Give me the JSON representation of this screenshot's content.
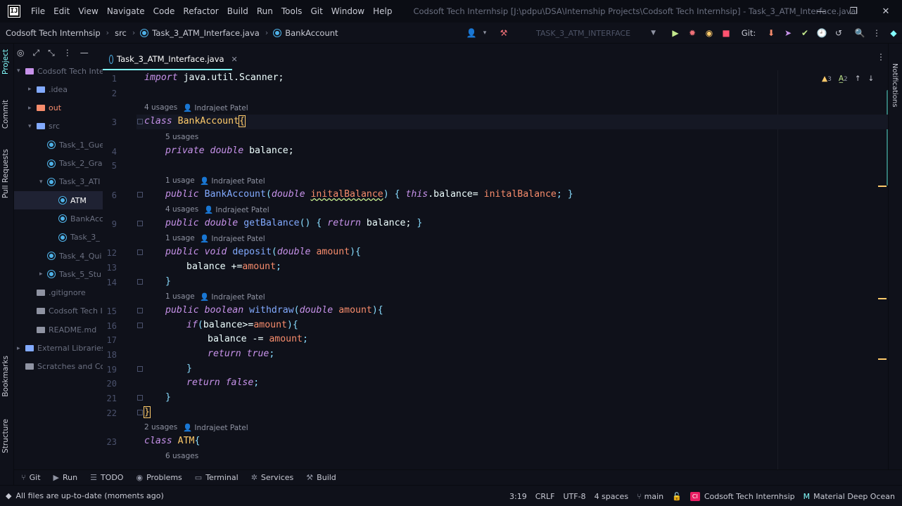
{
  "titlebar": {
    "logo": "IJ",
    "menu": [
      "File",
      "Edit",
      "View",
      "Navigate",
      "Code",
      "Refactor",
      "Build",
      "Run",
      "Tools",
      "Git",
      "Window",
      "Help"
    ],
    "title": "Codsoft Tech Internhsip [J:\\pdpu\\DSA\\Internship Projects\\Codsoft Tech Internhsip] - Task_3_ATM_Interface.java"
  },
  "navbar": {
    "crumbs": [
      "Codsoft Tech Internhsip",
      "src",
      "Task_3_ATM_Interface.java",
      "BankAccount"
    ],
    "run_config": "TASK_3_ATM_INTERFACE",
    "git_label": "Git:"
  },
  "left_tabs": {
    "project": "Project",
    "commit": "Commit",
    "pull_requests": "Pull Requests",
    "bookmarks": "Bookmarks",
    "structure": "Structure"
  },
  "right_tabs": {
    "notifications": "Notifications"
  },
  "project_tree": [
    {
      "label": "Codsoft Tech Inte",
      "indent": 0,
      "arrow": "▾",
      "type": "module"
    },
    {
      "label": ".idea",
      "indent": 1,
      "arrow": "▸",
      "type": "folder"
    },
    {
      "label": "out",
      "indent": 1,
      "arrow": "▸",
      "type": "folder-orange"
    },
    {
      "label": "src",
      "indent": 1,
      "arrow": "▾",
      "type": "folder"
    },
    {
      "label": "Task_1_Gue",
      "indent": 2,
      "arrow": "",
      "type": "java"
    },
    {
      "label": "Task_2_Gra",
      "indent": 2,
      "arrow": "",
      "type": "java"
    },
    {
      "label": "Task_3_ATI",
      "indent": 2,
      "arrow": "▾",
      "type": "java"
    },
    {
      "label": "ATM",
      "indent": 3,
      "arrow": "",
      "type": "java",
      "selected": true
    },
    {
      "label": "BankAcc",
      "indent": 3,
      "arrow": "",
      "type": "java"
    },
    {
      "label": "Task_3_",
      "indent": 3,
      "arrow": "",
      "type": "java"
    },
    {
      "label": "Task_4_Qui",
      "indent": 2,
      "arrow": "",
      "type": "java"
    },
    {
      "label": "Task_5_Stu",
      "indent": 2,
      "arrow": "▸",
      "type": "java"
    },
    {
      "label": ".gitignore",
      "indent": 1,
      "arrow": "",
      "type": "file"
    },
    {
      "label": "Codsoft Tech I",
      "indent": 1,
      "arrow": "",
      "type": "file"
    },
    {
      "label": "README.md",
      "indent": 1,
      "arrow": "",
      "type": "md"
    },
    {
      "label": "External Libraries",
      "indent": 0,
      "arrow": "▸",
      "type": "lib"
    },
    {
      "label": "Scratches and Co",
      "indent": 0,
      "arrow": "",
      "type": "scratch"
    }
  ],
  "editor": {
    "tab": "Task_3_ATM_Interface.java",
    "inspections": {
      "warnings": "3",
      "typos": "2"
    },
    "hints": {
      "h3": "4 usages",
      "h3_author": "Indrajeet Patel",
      "h4": "5 usages",
      "h6": "1 usage",
      "h6_author": "Indrajeet Patel",
      "h9": "4 usages",
      "h9_author": "Indrajeet Patel",
      "h12": "1 usage",
      "h12_author": "Indrajeet Patel",
      "h15": "1 usage",
      "h15_author": "Indrajeet Patel",
      "h23": "2 usages",
      "h23_author": "Indrajeet Patel",
      "h24": "6 usages"
    },
    "line_numbers": {
      "l1": "1",
      "l2": "2",
      "l3": "3",
      "l4": "4",
      "l5": "5",
      "l6": "6",
      "l9": "9",
      "l12": "12",
      "l13": "13",
      "l14": "14",
      "l15": "15",
      "l16": "16",
      "l17": "17",
      "l18": "18",
      "l19": "19",
      "l20": "20",
      "l21": "21",
      "l22": "22",
      "l23": "23"
    },
    "code": {
      "import_kw": "import",
      "import_rest": " java.util.Scanner;",
      "class_kw": "class",
      "bank_cls": "BankAccount",
      "private_kw": "private",
      "double_kw": "double",
      "balance_decl": " balance;",
      "public_kw": "public",
      "ctor_name": "BankAccount",
      "initial_param": "initalBalance",
      "this_kw": "this",
      "this_rest": ".balance= ",
      "initial_ref": "initalBalance",
      "get_balance": "getBalance",
      "return_kw": "return",
      "balance_ref": " balance; ",
      "void_kw": "void",
      "deposit_fn": "deposit",
      "amount": "amount",
      "balance_plus": "balance +=",
      "boolean_kw": "boolean",
      "withdraw_fn": "withdraw",
      "if_kw": "if",
      "if_cond": "balance>=",
      "balance_minus": "balance -= ",
      "true_kw": "true",
      "false_kw": "false",
      "atm_cls": "ATM"
    }
  },
  "bottom_tools": [
    "Git",
    "Run",
    "TODO",
    "Problems",
    "Terminal",
    "Services",
    "Build"
  ],
  "statusbar": {
    "message": "All files are up-to-date (moments ago)",
    "position": "3:19",
    "line_sep": "CRLF",
    "encoding": "UTF-8",
    "indent": "4 spaces",
    "branch": "main",
    "project": "Codsoft Tech Internhsip",
    "theme": "Material Deep Ocean"
  },
  "colors": {
    "accent": "#84ffff",
    "keyword": "#c792ea",
    "class": "#ffcb6b",
    "function": "#82aaff",
    "param": "#f78c6c",
    "punct": "#89ddff"
  }
}
